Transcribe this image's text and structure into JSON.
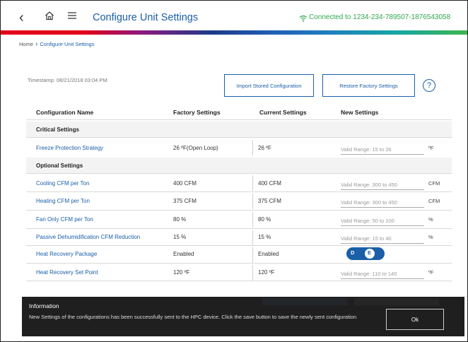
{
  "header": {
    "title": "Configure Unit Settings",
    "connection": "Connected to 1234-234-789507-1876543058",
    "icons": [
      "back-icon",
      "home-icon",
      "menu-icon",
      "wifi-icon"
    ]
  },
  "breadcrumb": {
    "home": "Home",
    "current": "Configure Unit Settings"
  },
  "timestamp": "Timestamp: 08/21/2018 03:04 PM",
  "actions": {
    "import_label": "Import Stored Configuration",
    "restore_label": "Restore Factory Settings",
    "help_glyph": "?"
  },
  "columns": {
    "name": "Configuration Name",
    "factory": "Factory Settings",
    "current": "Current Settings",
    "new": "New Settings"
  },
  "sections": {
    "critical": "Critical Settings",
    "optional": "Optional Settings"
  },
  "rows": [
    {
      "name": "Freeze Protection Strategy",
      "factory": "26 ºF(Open Loop)",
      "current": "26 ºF",
      "placeholder": "Valid Range: 15 to 26",
      "unit": "ºF"
    },
    {
      "name": "Cooling CFM per Ton",
      "factory": "400 CFM",
      "current": "400 CFM",
      "placeholder": "Valid Range: 300 to 450",
      "unit": "CFM"
    },
    {
      "name": "Heating CFM per Ton",
      "factory": "375 CFM",
      "current": "375 CFM",
      "placeholder": "Valid Range: 300 to 450",
      "unit": "CFM"
    },
    {
      "name": "Fan Only CFM per Ton",
      "factory": "80 %",
      "current": "80 %",
      "placeholder": "Valid Range: 50 to 100",
      "unit": "%"
    },
    {
      "name": "Passive Dehumidification CFM Reduction",
      "factory": "15 %",
      "current": "15 %",
      "placeholder": "Valid Range: 15 to 40",
      "unit": "%"
    },
    {
      "name": "Heat Recovery Package",
      "factory": "Enabled",
      "current": "Enabled",
      "toggle": {
        "off_label": "D",
        "on_label": "E",
        "state": "E"
      }
    },
    {
      "name": "Heat Recovery Set Point",
      "factory": "120 ºF",
      "current": "120 ºF",
      "placeholder": "Valid Range: 110 to 140",
      "unit": "ºF"
    }
  ],
  "notification": {
    "title": "Information",
    "message": "New Settings of the configurations has been successfully sent to the HPC device. Click the save button to save the newly sent configuration",
    "ok_label": "Ok"
  },
  "colors": {
    "accent": "#1a5fa8",
    "connected": "#2fa84f",
    "overlay": "#1f1f1f"
  }
}
